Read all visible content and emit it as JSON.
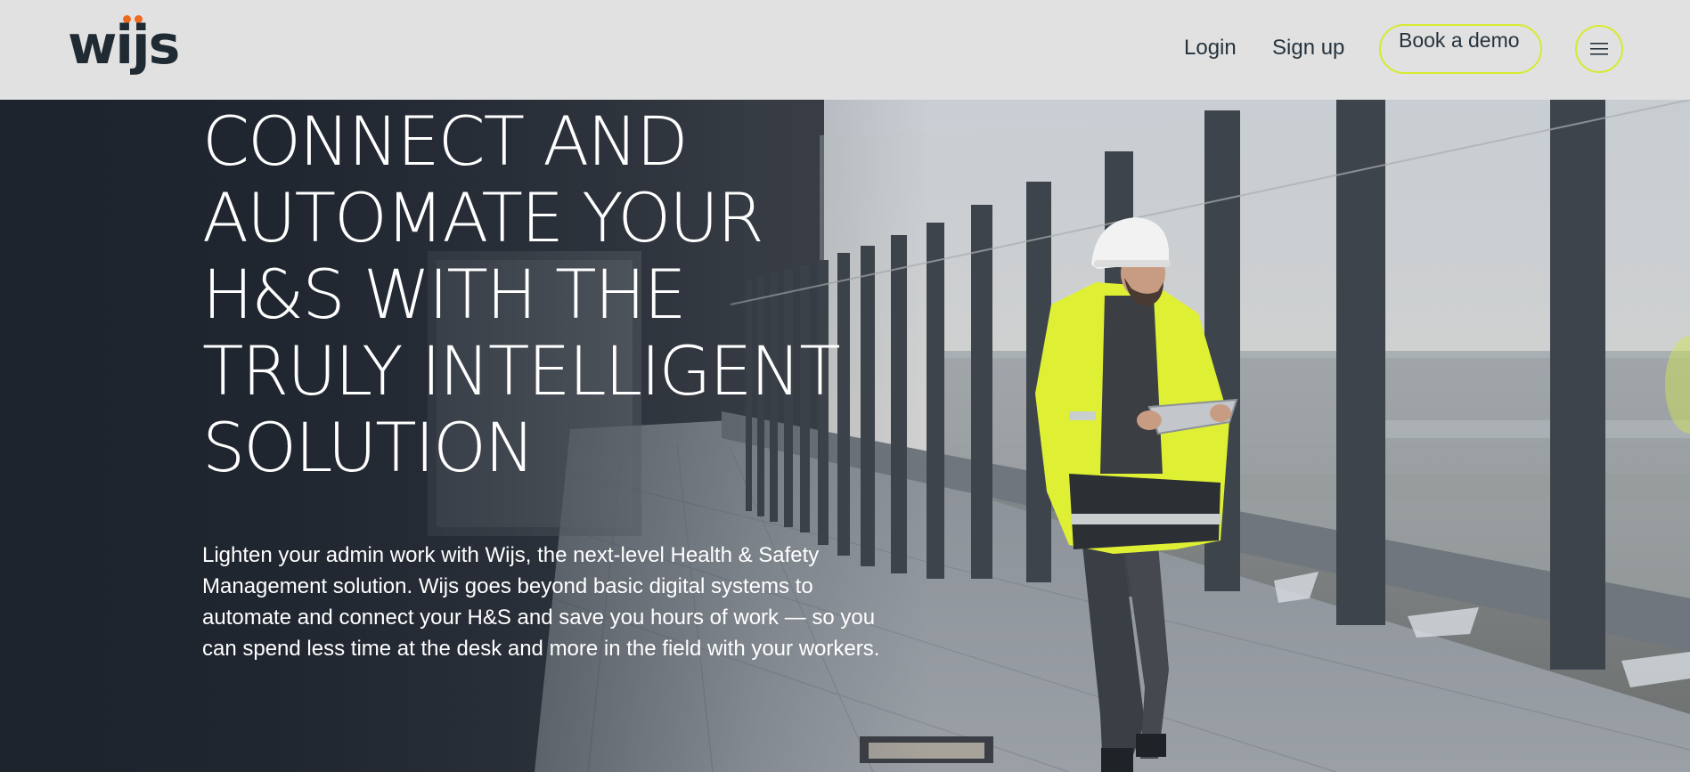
{
  "brand": {
    "logo_text": "wijs"
  },
  "nav": {
    "login": "Login",
    "signup": "Sign up",
    "book_demo": "Book a demo"
  },
  "hero": {
    "title": "CONNECT AND\nAUTOMATE YOUR\nH&S WITH THE\nTRULY INTELLIGENT\nSOLUTION",
    "subtitle": "Lighten your admin work with Wijs, the next-level Health & Safety Management solution. Wijs goes beyond basic digital systems to automate and connect your H&S and save you hours of work — so you can spend less time at the desk and more in the field with your workers."
  },
  "icons": {
    "menu": "hamburger-menu-icon",
    "photo": "worker-on-rooftop-photo"
  },
  "colors": {
    "accent": "#d6ea2f",
    "brand_dark": "#1f2a33",
    "logo_dot": "#f06a1e",
    "header_bg": "#e1e1e1"
  }
}
